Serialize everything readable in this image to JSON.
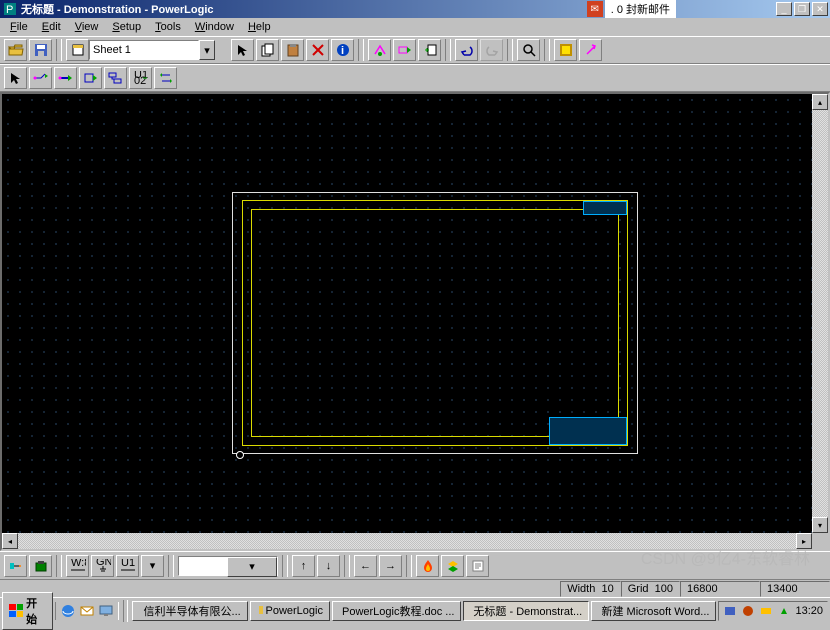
{
  "title": "无标题 - Demonstration - PowerLogic",
  "mail_notice": ". 0 封新邮件",
  "menubar": [
    "File",
    "Edit",
    "View",
    "Setup",
    "Tools",
    "Window",
    "Help"
  ],
  "sheet_selector": "Sheet 1",
  "statusbar": {
    "width_label": "Width",
    "width_value": "10",
    "grid_label": "Grid",
    "grid_value": "100",
    "x": "16800",
    "y": "13400"
  },
  "taskbar": {
    "start": "开始",
    "items": [
      {
        "label": "信利半导体有限公..."
      },
      {
        "label": "PowerLogic"
      },
      {
        "label": "PowerLogic教程.doc ..."
      },
      {
        "label": "无标题 - Demonstrat..."
      },
      {
        "label": "新建 Microsoft Word..."
      }
    ],
    "clock": "13:20"
  },
  "watermark": "CSDN @9亿4-东软睿林"
}
